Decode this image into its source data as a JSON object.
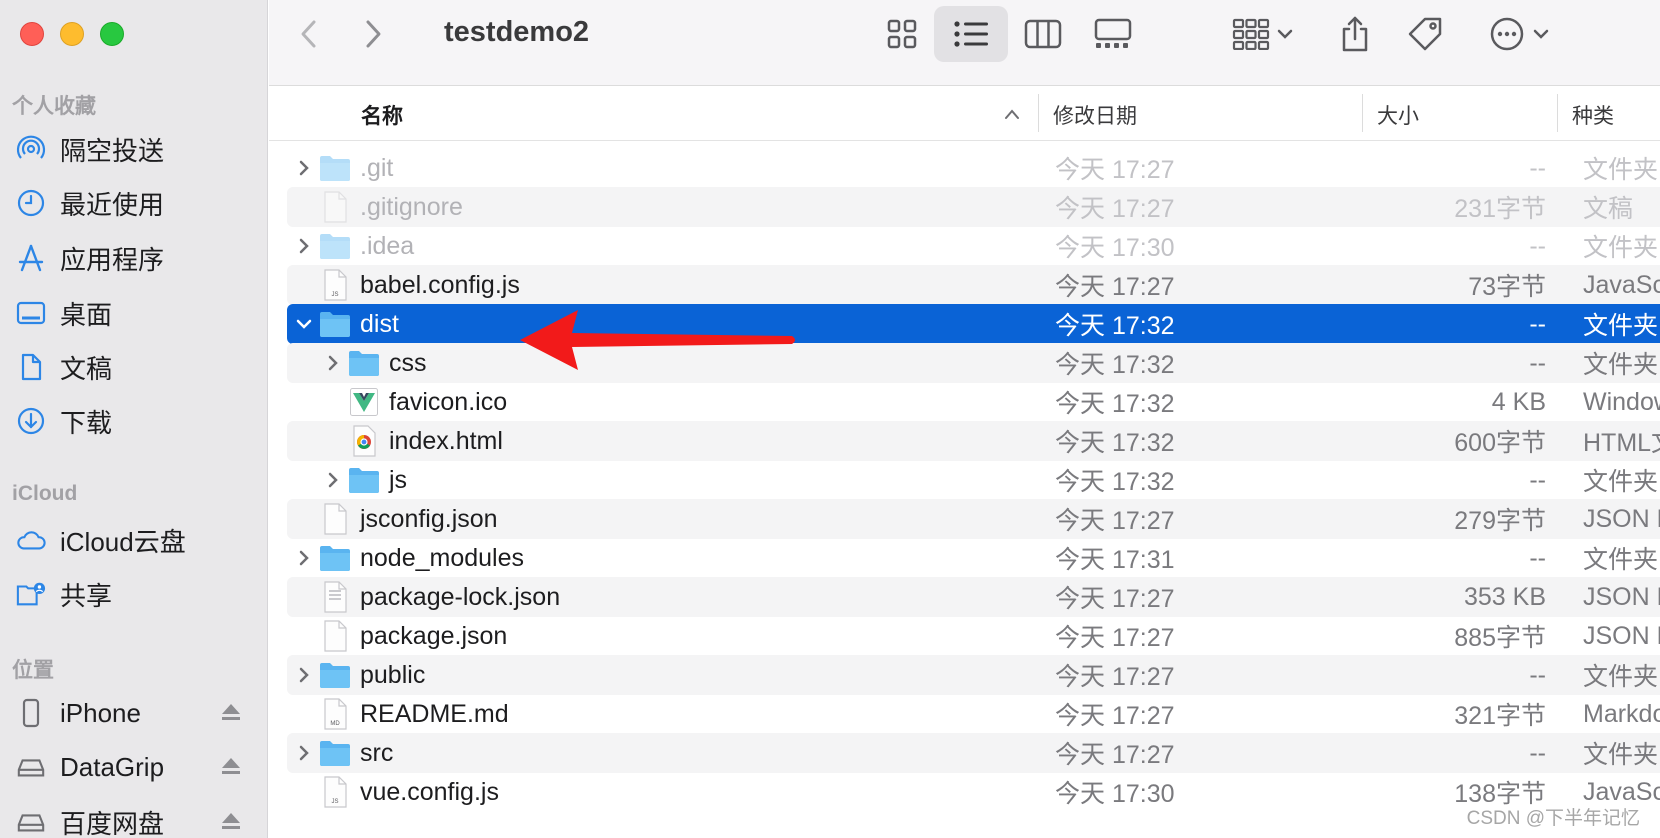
{
  "window": {
    "title": "testdemo2"
  },
  "sidebar": {
    "favorites_header": "个人收藏",
    "favorites": [
      {
        "label": "隔空投送",
        "icon": "airdrop-icon"
      },
      {
        "label": "最近使用",
        "icon": "clock-icon"
      },
      {
        "label": "应用程序",
        "icon": "applications-icon"
      },
      {
        "label": "桌面",
        "icon": "desktop-icon"
      },
      {
        "label": "文稿",
        "icon": "document-icon"
      },
      {
        "label": "下载",
        "icon": "download-icon"
      }
    ],
    "icloud_header": "iCloud",
    "icloud": [
      {
        "label": "iCloud云盘",
        "icon": "cloud-icon"
      },
      {
        "label": "共享",
        "icon": "shared-folder-icon"
      }
    ],
    "locations_header": "位置",
    "locations": [
      {
        "label": "iPhone",
        "icon": "iphone-icon"
      },
      {
        "label": "DataGrip",
        "icon": "drive-icon"
      },
      {
        "label": "百度网盘",
        "icon": "drive-icon"
      }
    ]
  },
  "columns": {
    "name": "名称",
    "date": "修改日期",
    "size": "大小",
    "kind": "种类"
  },
  "files": [
    {
      "name": ".git",
      "date": "今天 17:27",
      "size": "--",
      "kind": "文件夹",
      "type": "folder",
      "expand": "collapsed",
      "level": 0,
      "state": "dim"
    },
    {
      "name": ".gitignore",
      "date": "今天 17:27",
      "size": "231字节",
      "kind": "文稿",
      "type": "file",
      "expand": "none",
      "level": 0,
      "state": "dim"
    },
    {
      "name": ".idea",
      "date": "今天 17:30",
      "size": "--",
      "kind": "文件夹",
      "type": "folder",
      "expand": "collapsed",
      "level": 0,
      "state": "dim"
    },
    {
      "name": "babel.config.js",
      "date": "今天 17:27",
      "size": "73字节",
      "kind": "JavaScr",
      "type": "js",
      "expand": "none",
      "level": 0,
      "state": "normal"
    },
    {
      "name": "dist",
      "date": "今天 17:32",
      "size": "--",
      "kind": "文件夹",
      "type": "folder",
      "expand": "expanded",
      "level": 0,
      "state": "selected"
    },
    {
      "name": "css",
      "date": "今天 17:32",
      "size": "--",
      "kind": "文件夹",
      "type": "folder",
      "expand": "collapsed",
      "level": 1,
      "state": "normal"
    },
    {
      "name": "favicon.ico",
      "date": "今天 17:32",
      "size": "4 KB",
      "kind": "Window",
      "type": "vue-icon",
      "expand": "none",
      "level": 1,
      "state": "normal"
    },
    {
      "name": "index.html",
      "date": "今天 17:32",
      "size": "600字节",
      "kind": "HTML文",
      "type": "chrome",
      "expand": "none",
      "level": 1,
      "state": "normal"
    },
    {
      "name": "js",
      "date": "今天 17:32",
      "size": "--",
      "kind": "文件夹",
      "type": "folder",
      "expand": "collapsed",
      "level": 1,
      "state": "normal"
    },
    {
      "name": "jsconfig.json",
      "date": "今天 17:27",
      "size": "279字节",
      "kind": "JSON D",
      "type": "file",
      "expand": "none",
      "level": 0,
      "state": "normal"
    },
    {
      "name": "node_modules",
      "date": "今天 17:31",
      "size": "--",
      "kind": "文件夹",
      "type": "folder",
      "expand": "collapsed",
      "level": 0,
      "state": "normal"
    },
    {
      "name": "package-lock.json",
      "date": "今天 17:27",
      "size": "353 KB",
      "kind": "JSON D",
      "type": "file-lines",
      "expand": "none",
      "level": 0,
      "state": "normal"
    },
    {
      "name": "package.json",
      "date": "今天 17:27",
      "size": "885字节",
      "kind": "JSON D",
      "type": "file",
      "expand": "none",
      "level": 0,
      "state": "normal"
    },
    {
      "name": "public",
      "date": "今天 17:27",
      "size": "--",
      "kind": "文件夹",
      "type": "folder",
      "expand": "collapsed",
      "level": 0,
      "state": "normal"
    },
    {
      "name": "README.md",
      "date": "今天 17:27",
      "size": "321字节",
      "kind": "Markdo",
      "type": "md",
      "expand": "none",
      "level": 0,
      "state": "normal"
    },
    {
      "name": "src",
      "date": "今天 17:27",
      "size": "--",
      "kind": "文件夹",
      "type": "folder",
      "expand": "collapsed",
      "level": 0,
      "state": "normal"
    },
    {
      "name": "vue.config.js",
      "date": "今天 17:30",
      "size": "138字节",
      "kind": "JavaScr",
      "type": "js",
      "expand": "none",
      "level": 0,
      "state": "normal"
    }
  ],
  "watermark": "CSDN @下半年记忆",
  "colors": {
    "selection": "#0a63d6",
    "folder": "#5ab4f0",
    "arrow": "#f21a1a"
  }
}
